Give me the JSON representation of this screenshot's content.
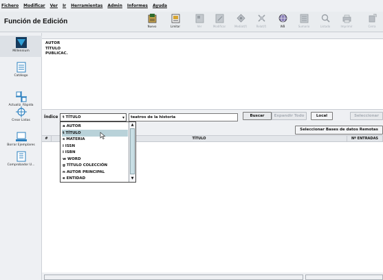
{
  "menu": [
    "Fichero",
    "Modificar",
    "Ver",
    "Ir",
    "Herramientas",
    "Admin",
    "Informes",
    "Ayuda"
  ],
  "title": "Función de Edición",
  "toolbar": [
    {
      "label": "Nuevo",
      "icon": "new-record-icon",
      "enabled": true
    },
    {
      "label": "Limitar",
      "icon": "limit-icon",
      "enabled": true
    },
    {
      "label": "Ver",
      "icon": "view-icon",
      "enabled": false
    },
    {
      "label": "Modificar",
      "icon": "modify-icon",
      "enabled": false
    },
    {
      "label": "Mediat(f)",
      "icon": "mediate-icon",
      "enabled": false
    },
    {
      "label": "Relat(f)",
      "icon": "relate-icon",
      "enabled": false
    },
    {
      "label": "WB",
      "icon": "web-icon",
      "enabled": true
    },
    {
      "label": "Sumario",
      "icon": "summary-icon",
      "enabled": false
    },
    {
      "label": "Listado",
      "icon": "list-icon",
      "enabled": false
    },
    {
      "label": "Imprimir",
      "icon": "print-icon",
      "enabled": false
    },
    {
      "label": "Cerra",
      "icon": "close-icon",
      "enabled": false
    }
  ],
  "sidebar": [
    {
      "label": "Millennium",
      "icon": "millennium-logo-icon",
      "active": true
    },
    {
      "label": "Catálogo",
      "icon": "catalog-icon",
      "active": false
    },
    {
      "label": "Actualiz. Rápida",
      "icon": "quick-update-icon",
      "active": false
    },
    {
      "label": "Crear Listas",
      "icon": "create-lists-icon",
      "active": false
    },
    {
      "label": "Borrar Ejemplares",
      "icon": "delete-items-icon",
      "active": false
    },
    {
      "label": "Comprobador U...",
      "icon": "checker-icon",
      "active": false
    }
  ],
  "fields": [
    "AUTOR",
    "TÍTULO",
    "PUBLICAC."
  ],
  "search": {
    "index_label": "Índice",
    "index_value": "t TÍTULO",
    "query": "teatros de la historia",
    "buscar": "Buscar",
    "expandir": "Expandir Todo",
    "local": "Local",
    "seleccionar": "Seleccionar",
    "remote_dbs": "Seleccionar Bases de datos Remotas"
  },
  "results": {
    "columns": [
      "#",
      "TÍTULO",
      "Nº ENTRADAS"
    ]
  },
  "dropdown": {
    "options": [
      "a AUTOR",
      "t TÍTULO",
      "s MATERIA",
      "i ISSN",
      "i ISBN",
      "w WORD",
      "g TÍTULO COLECCIÓN",
      "n AUTOR PRINCIPAL",
      "e ENTIDAD"
    ],
    "selected_index": 1
  },
  "colors": {
    "highlight": "#b9d2d9",
    "title": "#111111",
    "background": "#eef0f3"
  }
}
